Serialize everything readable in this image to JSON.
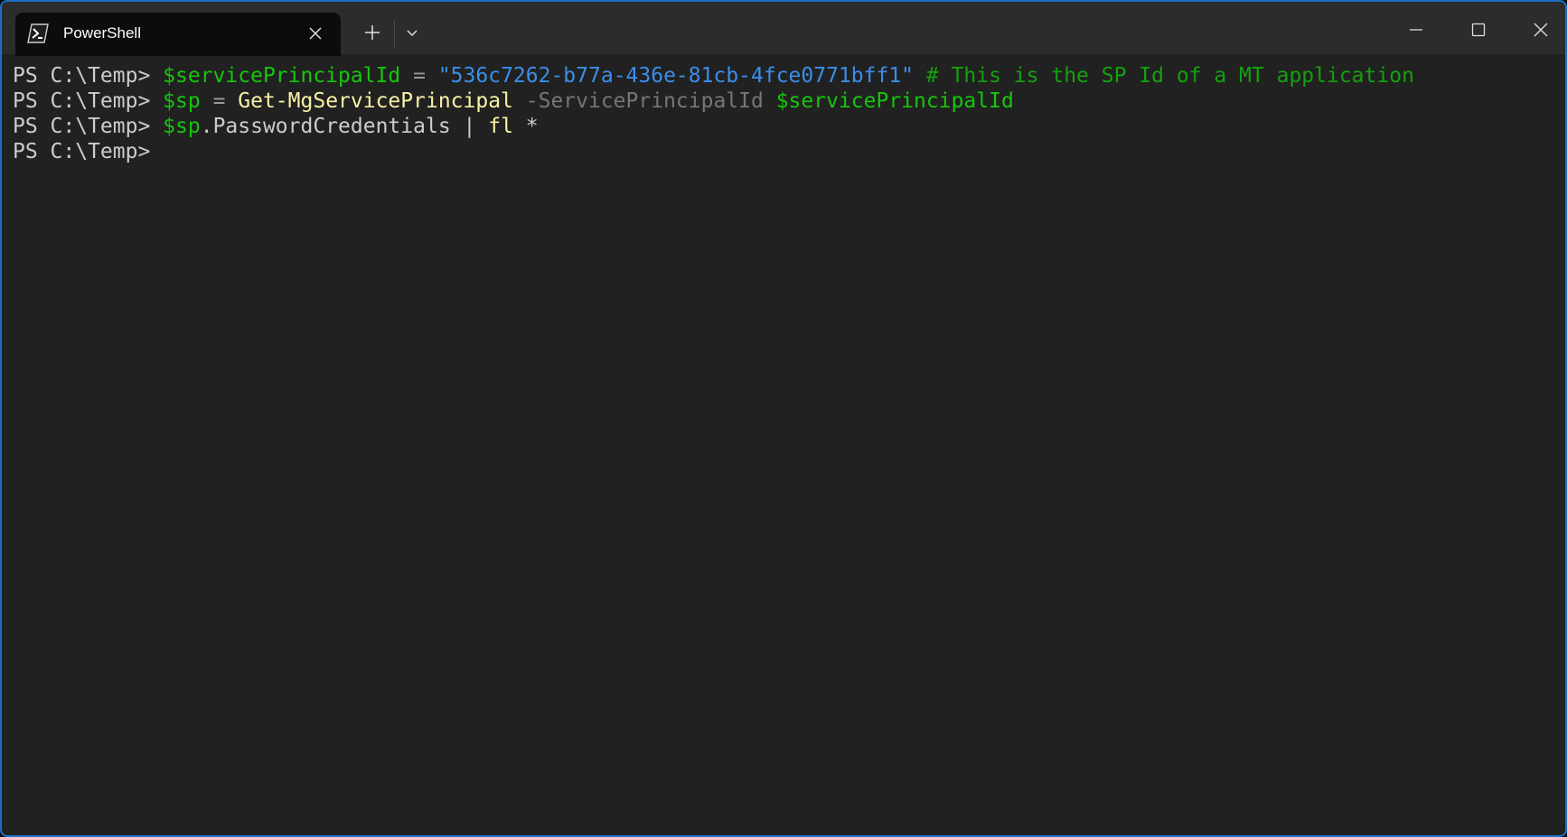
{
  "window": {
    "tab_title": "PowerShell",
    "accent_color": "#1c6fc4"
  },
  "icons": {
    "tab_icon": "powershell-icon",
    "tab_close": "close-icon",
    "new_tab": "plus-icon",
    "dropdown": "chevron-down-icon",
    "minimize": "minimize-icon",
    "maximize": "maximize-icon",
    "close": "close-icon"
  },
  "console": {
    "lines": [
      {
        "prompt": "PS C:\\Temp> ",
        "tokens": [
          {
            "text": "$servicePrincipalId",
            "type": "var"
          },
          {
            "text": " = ",
            "type": "op"
          },
          {
            "text": "\"536c7262-b77a-436e-81cb-4fce0771bff1\"",
            "type": "str"
          },
          {
            "text": " # This is the SP Id of a MT application",
            "type": "comment"
          }
        ]
      },
      {
        "prompt": "PS C:\\Temp> ",
        "tokens": [
          {
            "text": "$sp",
            "type": "var"
          },
          {
            "text": " = ",
            "type": "op"
          },
          {
            "text": "Get-MgServicePrincipal",
            "type": "cmd"
          },
          {
            "text": " -ServicePrincipalId ",
            "type": "param"
          },
          {
            "text": "$servicePrincipalId",
            "type": "var"
          }
        ]
      },
      {
        "prompt": "PS C:\\Temp> ",
        "tokens": [
          {
            "text": "$sp",
            "type": "var"
          },
          {
            "text": ".PasswordCredentials | ",
            "type": "plain"
          },
          {
            "text": "fl",
            "type": "cmd"
          },
          {
            "text": " *",
            "type": "plain"
          }
        ]
      },
      {
        "prompt": "PS C:\\Temp> ",
        "tokens": []
      }
    ]
  },
  "colors": {
    "background": "#212121",
    "titlebar": "#2c2c2c",
    "tab_active": "#0c0c0c",
    "variable": "#16c60c",
    "string": "#3b8eea",
    "comment": "#13a10e",
    "command": "#f9f1a5",
    "parameter": "#767676",
    "text": "#cccccc"
  }
}
